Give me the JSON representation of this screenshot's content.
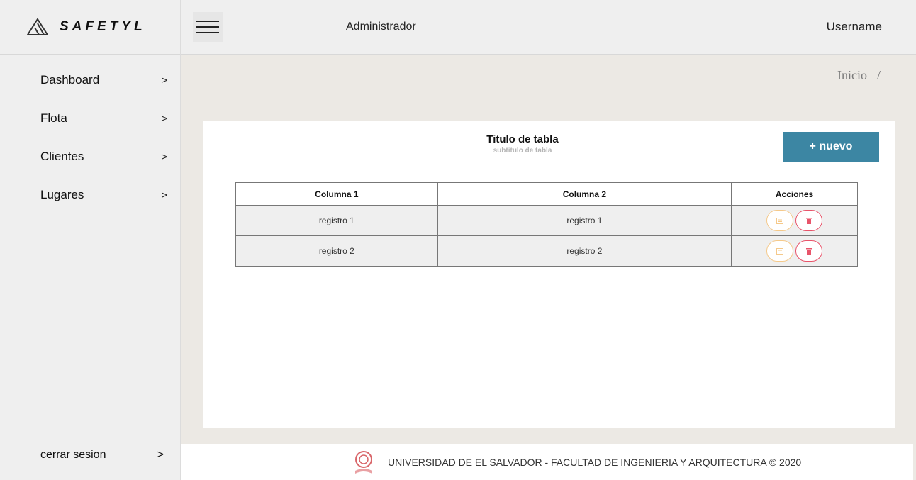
{
  "brand": {
    "name": "SAFETYL",
    "logo_icon": "mountain-logo-icon"
  },
  "topbar": {
    "role": "Administrador",
    "username": "Username",
    "menu_icon": "hamburger-icon"
  },
  "sidebar": {
    "items": [
      {
        "label": "Dashboard",
        "chevron": ">"
      },
      {
        "label": "Flota",
        "chevron": ">"
      },
      {
        "label": "Clientes",
        "chevron": ">"
      },
      {
        "label": "Lugares",
        "chevron": ">"
      }
    ],
    "logout": {
      "label": "cerrar sesion",
      "chevron": ">"
    }
  },
  "breadcrumb": {
    "current": "Inicio",
    "separator": "/"
  },
  "card": {
    "title": "Titulo de tabla",
    "subtitle": "subtitulo de tabla",
    "new_button": "+ nuevo",
    "accent_color": "#3c86a3"
  },
  "table": {
    "headers": [
      "Columna 1",
      "Columna 2",
      "Acciones"
    ],
    "rows": [
      [
        "registro 1",
        "registro 1"
      ],
      [
        "registro 2",
        "registro 2"
      ]
    ],
    "action_icons": [
      "edit-icon",
      "trash-icon"
    ]
  },
  "footer": {
    "text": "UNIVERSIDAD DE EL SALVADOR - FACULTAD DE INGENIERIA Y ARQUITECTURA © 2020",
    "seal_icon": "university-seal-icon"
  }
}
